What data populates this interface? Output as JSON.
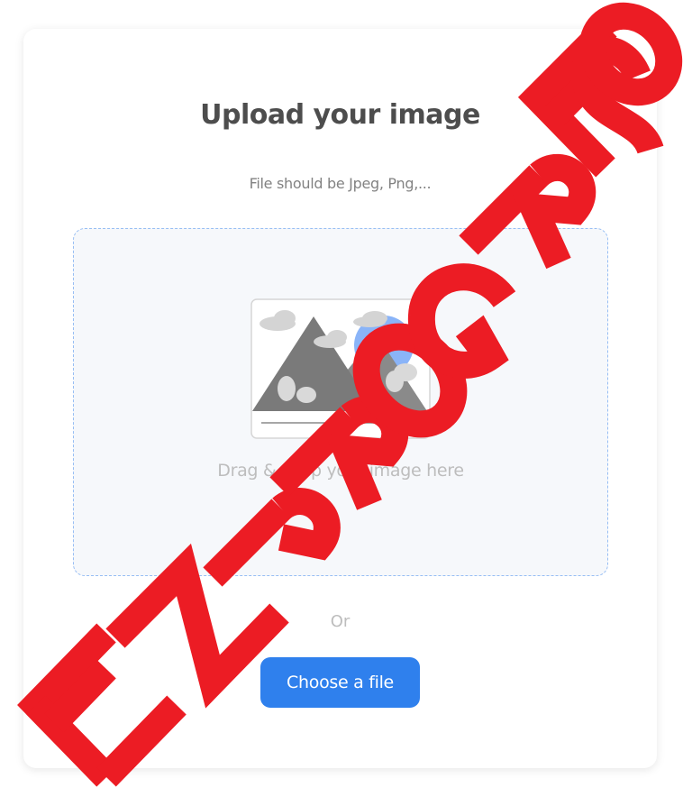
{
  "upload": {
    "title": "Upload your image",
    "subtitle": "File should be Jpeg, Png,...",
    "dropzone_text": "Drag & Drop your image here",
    "or_text": "Or",
    "choose_button_label": "Choose a file"
  },
  "watermark": {
    "text": "EN PROGRESO",
    "color": "#ec1c24"
  },
  "colors": {
    "accent": "#2f80ed",
    "title": "#4d4d4d",
    "muted": "#bdbdbd",
    "dropzone_bg": "#f6f8fb",
    "dropzone_border": "#97bef4"
  },
  "icons": {
    "illustration": "image-placeholder-icon"
  }
}
